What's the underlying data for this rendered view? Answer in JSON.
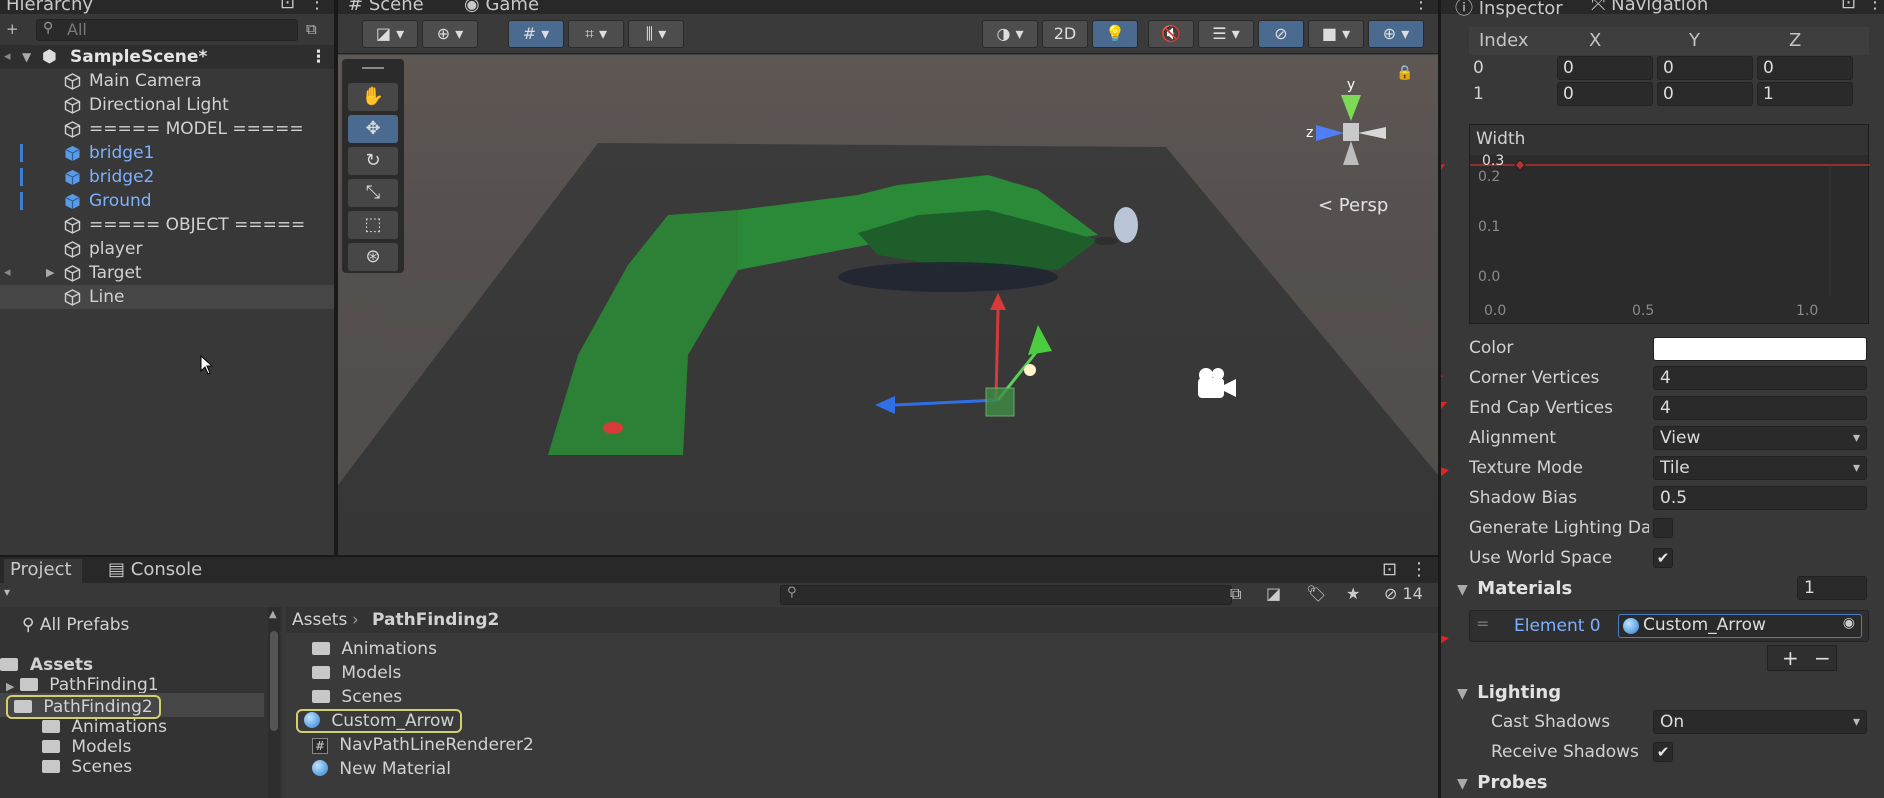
{
  "hierarchy": {
    "tab_label": "Hierarchy",
    "search_placeholder": "All",
    "scene_name": "SampleScene*",
    "items": [
      {
        "label": "Main Camera"
      },
      {
        "label": "Directional Light"
      },
      {
        "label": "===== MODEL ====="
      },
      {
        "label": "bridge1"
      },
      {
        "label": "bridge2"
      },
      {
        "label": "Ground"
      },
      {
        "label": "===== OBJECT ====="
      },
      {
        "label": "player"
      },
      {
        "label": "Target"
      },
      {
        "label": "Line"
      }
    ]
  },
  "scene": {
    "tabs": [
      "Scene",
      "Game"
    ],
    "mode_2d_label": "2D",
    "persp_label": "< Persp",
    "gizmo_y": "y",
    "gizmo_z": "z"
  },
  "inspector": {
    "tabs": [
      "Inspector",
      "Navigation"
    ],
    "positions_headers": [
      "Index",
      "X",
      "Y",
      "Z"
    ],
    "positions": [
      [
        "0",
        "0",
        "0",
        "0"
      ],
      [
        "1",
        "0",
        "0",
        "1"
      ]
    ],
    "width_label": "Width",
    "width_value": "0.3",
    "width_curve_y_ticks": [
      "0.2",
      "0.1",
      "0.0"
    ],
    "width_curve_x_ticks": [
      "0.0",
      "0.5",
      "1.0"
    ],
    "color_label": "Color",
    "color_value": "#ffffff",
    "corner_vertices_label": "Corner Vertices",
    "corner_vertices_value": "4",
    "end_cap_label": "End Cap Vertices",
    "end_cap_value": "4",
    "alignment_label": "Alignment",
    "alignment_value": "View",
    "texture_mode_label": "Texture Mode",
    "texture_mode_value": "Tile",
    "shadow_bias_label": "Shadow Bias",
    "shadow_bias_value": "0.5",
    "gen_lighting_label": "Generate Lighting Da",
    "use_world_space_label": "Use World Space",
    "materials_label": "Materials",
    "materials_count": "1",
    "element0_label": "Element 0",
    "element0_value": "Custom_Arrow",
    "lighting_label": "Lighting",
    "cast_shadows_label": "Cast Shadows",
    "cast_shadows_value": "On",
    "receive_shadows_label": "Receive Shadows",
    "probes_label": "Probes"
  },
  "project": {
    "tabs": [
      "Project",
      "Console"
    ],
    "hidden_count": "14",
    "breadcrumb": [
      "Assets",
      "PathFinding2"
    ],
    "left_items": [
      {
        "label": "All Prefabs"
      },
      {
        "label": "Assets"
      },
      {
        "label": "PathFinding1"
      },
      {
        "label": "PathFinding2"
      },
      {
        "label": "Animations"
      },
      {
        "label": "Models"
      },
      {
        "label": "Scenes"
      }
    ],
    "right_items": [
      {
        "label": "Animations"
      },
      {
        "label": "Models"
      },
      {
        "label": "Scenes"
      },
      {
        "label": "Custom_Arrow"
      },
      {
        "label": "NavPathLineRenderer2"
      },
      {
        "label": "New Material"
      }
    ]
  }
}
